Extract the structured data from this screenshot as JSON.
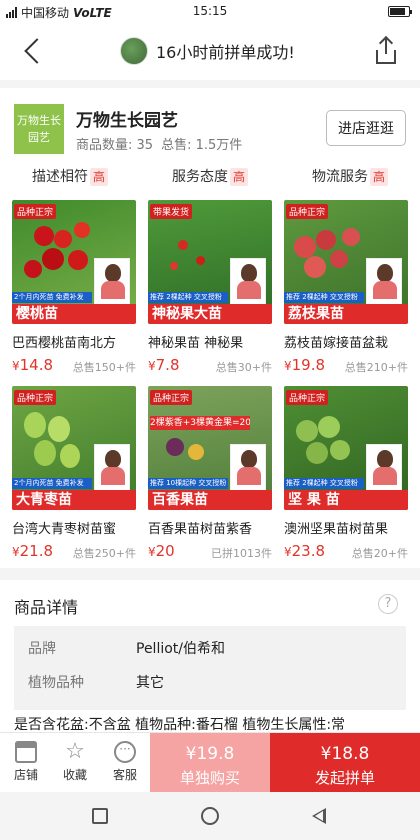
{
  "status_bar": {
    "carrier": "中国移动",
    "network": "VoLTE",
    "time": "15:15"
  },
  "header": {
    "title": "16小时前拼单成功!"
  },
  "store": {
    "logo_text": "万物生长园艺",
    "name": "万物生长园艺",
    "product_count": "商品数量: 35",
    "total_sales": "总售: 1.5万件",
    "visit_label": "进店逛逛",
    "ratings": [
      {
        "label": "描述相符",
        "level": "高"
      },
      {
        "label": "服务态度",
        "level": "高"
      },
      {
        "label": "物流服务",
        "level": "高"
      }
    ]
  },
  "products": [
    {
      "title": "巴西樱桃苗南北方",
      "price": "14.8",
      "sold": "总售150+件",
      "banner": "樱桃苗",
      "tag": "品种正宗",
      "strip": "2个月内死苗 免费补发"
    },
    {
      "title": "神秘果苗 神秘果",
      "price": "7.8",
      "sold": "总售30+件",
      "banner": "神秘果大苗",
      "tag": "带果发货",
      "strip": "推荐 2棵起种 交叉授粉"
    },
    {
      "title": "荔枝苗嫁接苗盆栽",
      "price": "19.8",
      "sold": "总售210+件",
      "banner": "荔枝果苗",
      "tag": "品种正宗",
      "strip": "推荐 2棵起种 交叉授粉"
    },
    {
      "title": "台湾大青枣树苗蜜",
      "price": "21.8",
      "sold": "总售250+件",
      "banner": "大青枣苗",
      "tag": "品种正宗",
      "strip": "2个月内死苗 免费补发"
    },
    {
      "title": "百香果苗树苗紫香",
      "price": "20",
      "sold": "已拼1013件",
      "banner": "百香果苗",
      "tag": "品种正宗",
      "strip": "推荐 10棵起种 交叉授粉"
    },
    {
      "title": "澳洲坚果苗树苗果",
      "price": "23.8",
      "sold": "总售20+件",
      "banner": "坚 果 苗",
      "tag": "品种正宗",
      "strip": "推荐 2棵起种 交叉授粉"
    }
  ],
  "product_overlay_text": "2棵紫香+3棵黄金果=20元",
  "currency": "¥",
  "details": {
    "title": "商品详情",
    "help": "?",
    "specs": [
      {
        "key": "品牌",
        "value": "Pelliot/伯希和"
      },
      {
        "key": "植物品种",
        "value": "其它"
      }
    ],
    "more": "是否含花盆:不含盆 植物品种:番石榴 植物生长属性:常"
  },
  "bottom_bar": {
    "shop": "店铺",
    "favorite": "收藏",
    "service": "客服",
    "single_price": "¥19.8",
    "single_label": "单独购买",
    "group_price": "¥18.8",
    "group_label": "发起拼单"
  },
  "colors": {
    "accent": "#e02b2b",
    "light_accent": "#f6a3a3",
    "logo_green": "#8fc24a"
  }
}
